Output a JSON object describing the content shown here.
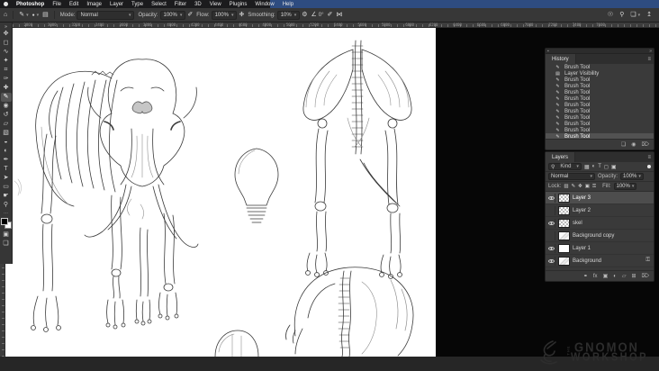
{
  "menu_bar": {
    "app_name": "Photoshop",
    "items": [
      "File",
      "Edit",
      "Image",
      "Layer",
      "Type",
      "Select",
      "Filter",
      "3D",
      "View",
      "Plugins",
      "Window",
      "Help"
    ]
  },
  "options_bar": {
    "mode_label": "Mode:",
    "mode_value": "Normal",
    "opacity_label": "Opacity:",
    "opacity_value": "100%",
    "flow_label": "Flow:",
    "flow_value": "100%",
    "smoothing_label": "Smoothing:",
    "smoothing_value": "10%",
    "angle_value": "0°"
  },
  "icons": {
    "chevron": "▾",
    "home": "⌂",
    "brush": "✎",
    "brush_preset": "●",
    "brush_panel": "▤",
    "pressure": "✐",
    "airbrush": "❉",
    "gear": "⚙",
    "angle": "∠",
    "symmetry": "⋈",
    "discover": "☉",
    "search": "⚲",
    "workspace": "❏",
    "share": "↥",
    "panel_dot": "▪",
    "collapse": "»",
    "menu": "≡",
    "new_doc": "❏",
    "snapshot": "◉",
    "trash": "⌦",
    "kind_search": "⚲",
    "filter_pixel": "▦",
    "filter_adjust": "◐",
    "filter_type": "T",
    "filter_shape": "◻",
    "filter_smart": "▣",
    "lock_checker": "▨",
    "lock_brush": "✎",
    "lock_move": "✥",
    "lock_artboard": "▣",
    "lock_all": "⚿",
    "link": "⚭",
    "fx": "fx",
    "mask": "▣",
    "adjust": "◐",
    "folder": "▱",
    "new_layer": "⊞",
    "lock_badge": "⚿"
  },
  "toolbar": {
    "tools": [
      {
        "name": "collapse-chevrons",
        "glyph": "»"
      },
      {
        "name": "move-tool",
        "glyph": "✥"
      },
      {
        "name": "marquee-tool",
        "glyph": "◻"
      },
      {
        "name": "lasso-tool",
        "glyph": "∿"
      },
      {
        "name": "quick-selection-tool",
        "glyph": "✦"
      },
      {
        "name": "crop-tool",
        "glyph": "⌗"
      },
      {
        "name": "eyedropper-tool",
        "glyph": "✑"
      },
      {
        "name": "healing-brush-tool",
        "glyph": "✚"
      },
      {
        "name": "brush-tool",
        "glyph": "✎"
      },
      {
        "name": "clone-stamp-tool",
        "glyph": "◉"
      },
      {
        "name": "history-brush-tool",
        "glyph": "↺"
      },
      {
        "name": "eraser-tool",
        "glyph": "▱"
      },
      {
        "name": "gradient-tool",
        "glyph": "▧"
      },
      {
        "name": "blur-tool",
        "glyph": "◒"
      },
      {
        "name": "dodge-tool",
        "glyph": "◐"
      },
      {
        "name": "pen-tool",
        "glyph": "✒"
      },
      {
        "name": "type-tool",
        "glyph": "T"
      },
      {
        "name": "path-selection-tool",
        "glyph": "➤"
      },
      {
        "name": "shape-tool",
        "glyph": "▭"
      },
      {
        "name": "hand-tool",
        "glyph": "☛"
      },
      {
        "name": "zoom-tool",
        "glyph": "⚲"
      },
      {
        "name": "edit-toolbar",
        "glyph": "⋯"
      }
    ],
    "bottom_tools": [
      {
        "name": "quick-mask-mode",
        "glyph": "▣"
      },
      {
        "name": "screen-mode",
        "glyph": "❏"
      }
    ]
  },
  "ruler": {
    "h_labels": "2600       2800       3000       3200       3400       3600       3800       4000       4200       4400       4600       4800       5000       5200       5400       5600       5800       6000       6200       6400       6600       6800       7000       7200       7400       7600"
  },
  "history_panel": {
    "title": "History",
    "items": [
      {
        "glyph": "✎",
        "label": "Brush Tool"
      },
      {
        "glyph": "▤",
        "label": "Layer Visibility"
      },
      {
        "glyph": "✎",
        "label": "Brush Tool"
      },
      {
        "glyph": "✎",
        "label": "Brush Tool"
      },
      {
        "glyph": "✎",
        "label": "Brush Tool"
      },
      {
        "glyph": "✎",
        "label": "Brush Tool"
      },
      {
        "glyph": "✎",
        "label": "Brush Tool"
      },
      {
        "glyph": "✎",
        "label": "Brush Tool"
      },
      {
        "glyph": "✎",
        "label": "Brush Tool"
      },
      {
        "glyph": "✎",
        "label": "Brush Tool"
      },
      {
        "glyph": "✎",
        "label": "Brush Tool"
      },
      {
        "glyph": "✎",
        "label": "Brush Tool"
      }
    ]
  },
  "layers_panel": {
    "title": "Layers",
    "filter_kind": "Kind",
    "blend_mode": "Normal",
    "opacity_label": "Opacity:",
    "opacity_value": "100%",
    "lock_label": "Lock:",
    "fill_label": "Fill:",
    "fill_value": "100%",
    "layers": [
      {
        "name": "Layer 3"
      },
      {
        "name": "Layer 2"
      },
      {
        "name": "skel"
      },
      {
        "name": "Background copy"
      },
      {
        "name": "Layer 1"
      },
      {
        "name": "Background"
      }
    ]
  },
  "logo": {
    "the": "THE",
    "line1": "GNOMON",
    "line2": "WORKSHOP"
  },
  "colors": {
    "menubar_blue": "#2e4c80",
    "panel_bg": "#3a3a3a",
    "selection_row": "#4d4d4d",
    "canvas_white": "#ffffff",
    "pasteboard": "#060606",
    "bottom_strip": "#262626"
  }
}
